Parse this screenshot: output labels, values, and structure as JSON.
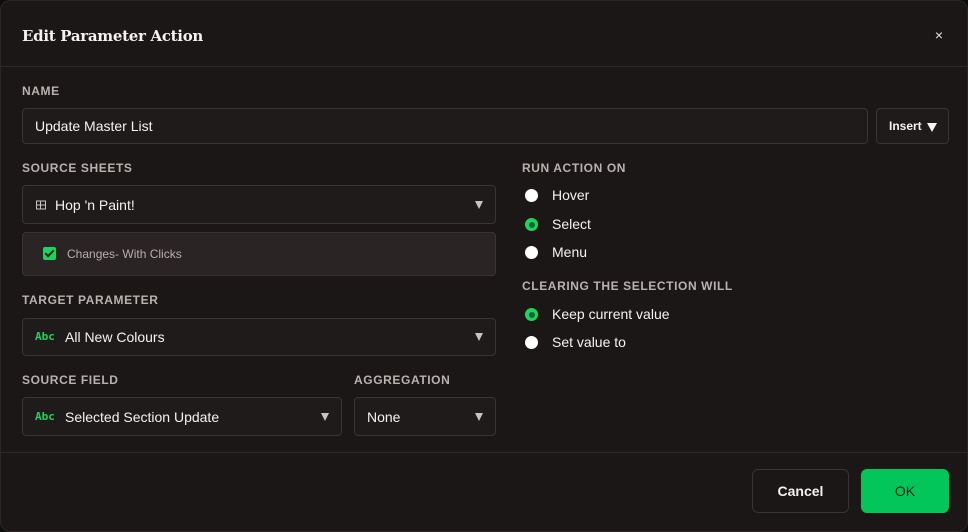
{
  "dialog": {
    "title": "Edit Parameter Action",
    "close_glyph": "×"
  },
  "name": {
    "label": "NAME",
    "value": "Update Master List",
    "insert_label": "Insert"
  },
  "source_sheets": {
    "label": "SOURCE SHEETS",
    "selected": "Hop 'n Paint!",
    "icon": "table-icon",
    "sub_item": {
      "label": "Changes- With Clicks",
      "checked": true
    }
  },
  "target_parameter": {
    "label": "TARGET PARAMETER",
    "type_badge": "Abc",
    "selected": "All New Colours"
  },
  "source_field": {
    "label": "SOURCE FIELD",
    "type_badge": "Abc",
    "selected": "Selected Section Update"
  },
  "aggregation": {
    "label": "AGGREGATION",
    "selected": "None"
  },
  "run_action_on": {
    "label": "RUN ACTION ON",
    "options": [
      {
        "label": "Hover",
        "selected": false
      },
      {
        "label": "Select",
        "selected": true
      },
      {
        "label": "Menu",
        "selected": false
      }
    ]
  },
  "clearing_selection": {
    "label": "CLEARING THE SELECTION WILL",
    "options": [
      {
        "label": "Keep current value",
        "selected": true
      },
      {
        "label": "Set value to",
        "selected": false
      }
    ]
  },
  "footer": {
    "cancel_label": "Cancel",
    "ok_label": "OK"
  },
  "colors": {
    "accent": "#03c65a",
    "background": "#1b1716",
    "field_border": "#3a3433"
  }
}
